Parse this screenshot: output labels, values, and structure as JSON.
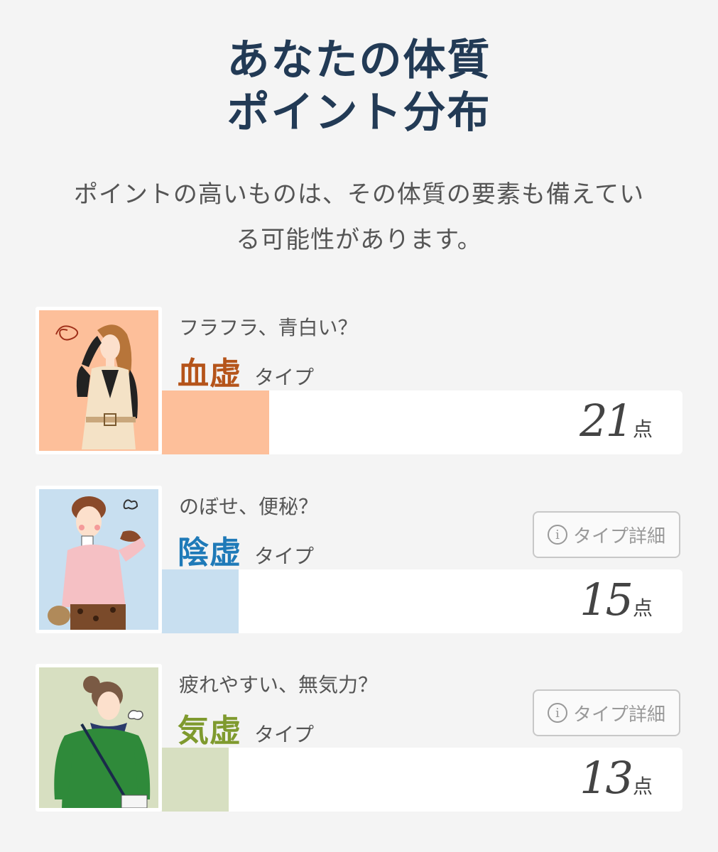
{
  "title": {
    "line1": "あなたの体質",
    "line2": "ポイント分布"
  },
  "description": {
    "line1": "ポイントの高いものは、その体質の要素も備えてい",
    "line2": "る可能性があります。"
  },
  "colors": {
    "title": "#223a55",
    "background": "#f4f4f4"
  },
  "types": [
    {
      "subtitle": "フラフラ、青白い？",
      "name": "血虚",
      "suffix": "タイプ",
      "name_color": "#b5541a",
      "bar_color": "#fdbf9a",
      "thumb_bg": "#fdbf9a",
      "score": "21",
      "unit": "点",
      "fill_fraction": 0.206,
      "icon": "woman-dizzy-illustration"
    },
    {
      "subtitle": "のぼせ、便秘？",
      "name": "陰虚",
      "suffix": "タイプ",
      "name_color": "#1f7ab8",
      "bar_color": "#c8dff0",
      "thumb_bg": "#c8dff0",
      "score": "15",
      "unit": "点",
      "fill_fraction": 0.147,
      "detail_button": "タイプ詳細",
      "icon": "woman-drinking-illustration"
    },
    {
      "subtitle": "疲れやすい、無気力？",
      "name": "気虚",
      "suffix": "タイプ",
      "name_color": "#7f9a2e",
      "bar_color": "#d7dfc1",
      "thumb_bg": "#d7dfc1",
      "score": "13",
      "unit": "点",
      "fill_fraction": 0.128,
      "detail_button": "タイプ詳細",
      "icon": "woman-tired-illustration"
    }
  ]
}
